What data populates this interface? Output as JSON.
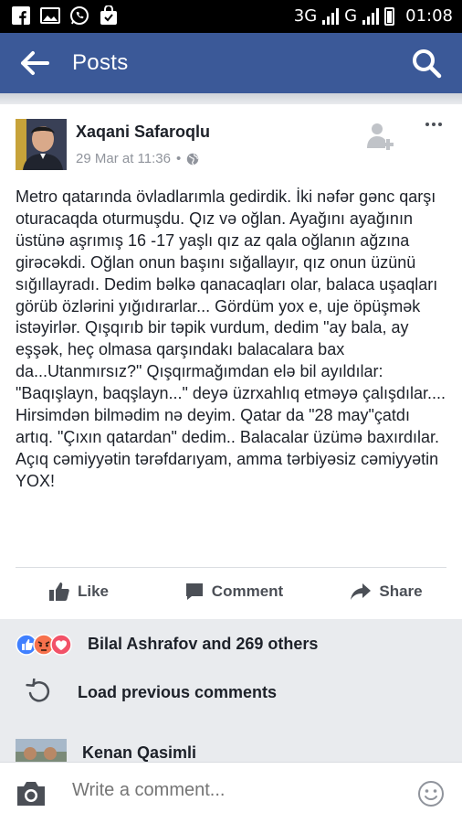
{
  "status_bar": {
    "network_1": "3G",
    "network_2": "G",
    "time": "01:08",
    "icons": [
      "facebook-icon",
      "gallery-icon",
      "whatsapp-icon",
      "shopping-bag-icon"
    ]
  },
  "app_bar": {
    "title": "Posts",
    "back_icon": "arrow-left-icon",
    "search_icon": "search-icon",
    "color": "#3b5998"
  },
  "post": {
    "author": "Xaqani Safaroqlu",
    "timestamp": "29 Mar at 11:36",
    "separator": "•",
    "privacy_icon": "globe-icon",
    "text": "Metro qatarında övladlarımla gedirdik. İki nəfər gənc qarşı oturacaqda oturmuşdu. Qız və oğlan. Ayağını ayağının üstünə aşrımış 16 -17 yaşlı qız az qala oğlanın ağzına girəcəkdi. Oğlan onun başını sığallayır, qız onun üzünü sığıllayradı. Dedim bəlkə qanacaqları olar, balaca uşaqları görüb özlərini yığıdırarlar... Gördüm yox e, uje öpüşmək istəyirlər. Qışqırıb bir təpik vurdum, dedim \"ay bala, ay eşşək, heç olmasa qarşındakı balacalara bax da...Utanmırsız?\" Qışqırmağımdan elə bil ayıldılar: \"Baqışlayn, baqşlayn...\" deyə üzrxahlıq etməyə çalışdılar.... Hirsimdən bilmədim nə deyim. Qatar da \"28 may\"çatdı artıq. \"Çıxın qatardan\" dedim.. Balacalar üzümə baxırdılar.\nAçıq cəmiyyətin tərəfdarıyam, amma tərbiyəsiz cəmiyyətin YOX!",
    "actions": {
      "like": "Like",
      "comment": "Comment",
      "share": "Share"
    }
  },
  "reactions": {
    "summary": "Bilal Ashrafov and 269 others",
    "types": [
      "like-reaction-icon",
      "angry-reaction-icon",
      "love-reaction-icon"
    ]
  },
  "comments": {
    "load_previous": "Load previous comments",
    "first_commenter": "Kenan Qasimli"
  },
  "composer": {
    "placeholder": "Write a comment..."
  }
}
